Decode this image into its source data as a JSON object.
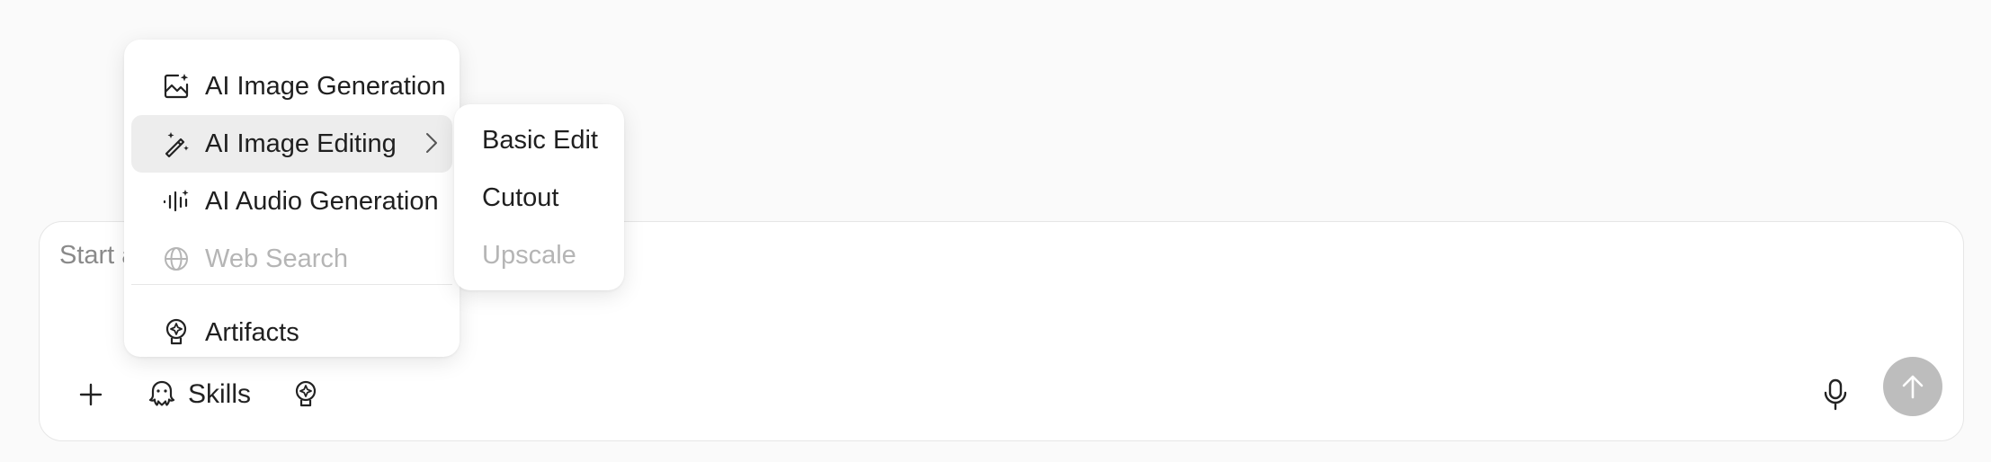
{
  "composer": {
    "placeholder": "Start a",
    "skills_label": "Skills"
  },
  "menu": {
    "items": [
      {
        "label": "AI Image Generation",
        "icon": "image-sparkle-icon",
        "state": "normal"
      },
      {
        "label": "AI Image Editing",
        "icon": "wand-icon",
        "state": "active",
        "has_submenu": true
      },
      {
        "label": "AI Audio Generation",
        "icon": "audio-wave-icon",
        "state": "normal"
      },
      {
        "label": "Web Search",
        "icon": "globe-icon",
        "state": "disabled"
      },
      {
        "label": "Artifacts",
        "icon": "artifact-icon",
        "state": "normal"
      }
    ]
  },
  "submenu": {
    "items": [
      {
        "label": "Basic Edit",
        "state": "normal"
      },
      {
        "label": "Cutout",
        "state": "normal"
      },
      {
        "label": "Upscale",
        "state": "disabled"
      }
    ]
  },
  "colors": {
    "background": "#fafafa",
    "panel": "#ffffff",
    "active_item": "#ededed",
    "disabled_text": "#b5b5b5",
    "send_button": "#bdbdbd"
  }
}
